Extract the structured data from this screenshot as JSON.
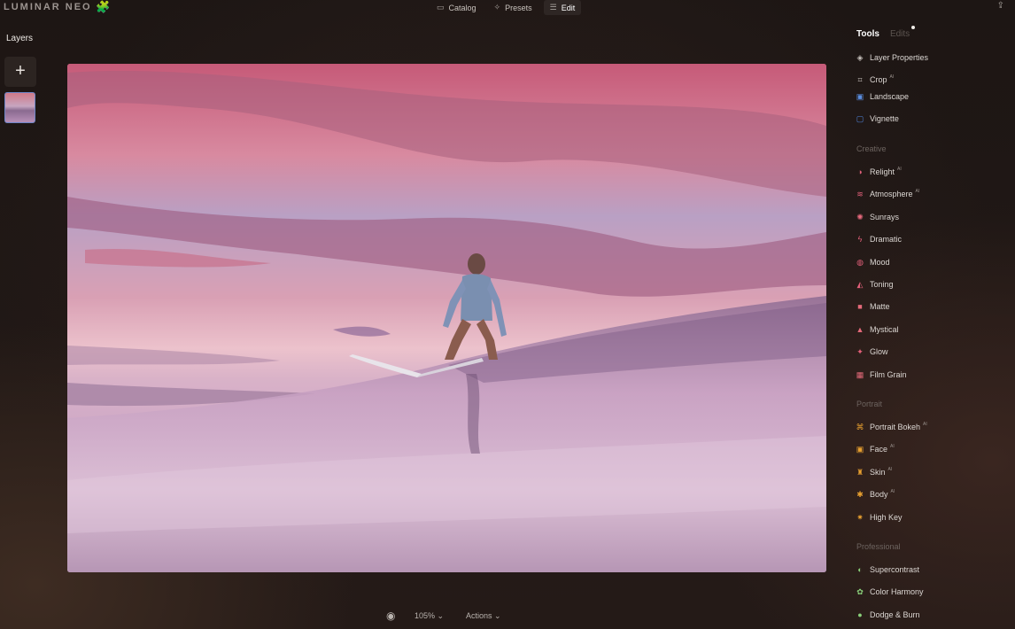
{
  "app": {
    "logo_text": "LUMINAR NEO",
    "logo_badge": "🧩"
  },
  "nav": {
    "catalog": "Catalog",
    "presets": "Presets",
    "edit": "Edit",
    "active": "Edit"
  },
  "layers": {
    "title": "Layers",
    "add_symbol": "+"
  },
  "bottom": {
    "zoom": "105% ⌄",
    "actions": "Actions ⌄"
  },
  "right_panel": {
    "tab_tools": "Tools",
    "tab_edits": "Edits",
    "ai_badge": "AI",
    "tools_top": [
      {
        "label": "Layer Properties",
        "icon": "layers-icon",
        "color": "#c8c2bd",
        "ai": false
      },
      {
        "label": "Crop",
        "icon": "crop-icon",
        "color": "#c8c2bd",
        "ai": true
      },
      {
        "label": "Landscape",
        "icon": "landscape-icon",
        "color": "#5b8ee0",
        "ai": false
      },
      {
        "label": "Vignette",
        "icon": "vignette-icon",
        "color": "#4e82d8",
        "ai": false
      }
    ],
    "section_creative": "Creative",
    "tools_creative": [
      {
        "label": "Relight",
        "icon": "relight-icon",
        "color": "#e0607a",
        "ai": true
      },
      {
        "label": "Atmosphere",
        "icon": "atmosphere-icon",
        "color": "#e0607a",
        "ai": true
      },
      {
        "label": "Sunrays",
        "icon": "sunrays-icon",
        "color": "#e86a7e",
        "ai": false
      },
      {
        "label": "Dramatic",
        "icon": "dramatic-icon",
        "color": "#e4607a",
        "ai": false
      },
      {
        "label": "Mood",
        "icon": "mood-icon",
        "color": "#e4607a",
        "ai": false
      },
      {
        "label": "Toning",
        "icon": "toning-icon",
        "color": "#e4607a",
        "ai": false
      },
      {
        "label": "Matte",
        "icon": "matte-icon",
        "color": "#e46a7a",
        "ai": false
      },
      {
        "label": "Mystical",
        "icon": "mystical-icon",
        "color": "#e46a7a",
        "ai": false
      },
      {
        "label": "Glow",
        "icon": "glow-icon",
        "color": "#e4607a",
        "ai": false
      },
      {
        "label": "Film Grain",
        "icon": "film-grain-icon",
        "color": "#e46a7a",
        "ai": false
      }
    ],
    "section_portrait": "Portrait",
    "tools_portrait": [
      {
        "label": "Portrait Bokeh",
        "icon": "portrait-bokeh-icon",
        "color": "#e8a030",
        "ai": true
      },
      {
        "label": "Face",
        "icon": "face-icon",
        "color": "#e8a030",
        "ai": true
      },
      {
        "label": "Skin",
        "icon": "skin-icon",
        "color": "#e8a030",
        "ai": true
      },
      {
        "label": "Body",
        "icon": "body-icon",
        "color": "#e8a030",
        "ai": true
      },
      {
        "label": "High Key",
        "icon": "high-key-icon",
        "color": "#e8a030",
        "ai": false
      }
    ],
    "section_professional": "Professional",
    "tools_professional": [
      {
        "label": "Supercontrast",
        "icon": "supercontrast-icon",
        "color": "#8ad07a",
        "ai": false
      },
      {
        "label": "Color Harmony",
        "icon": "color-harmony-icon",
        "color": "#8ad07a",
        "ai": false
      },
      {
        "label": "Dodge & Burn",
        "icon": "dodge-burn-icon",
        "color": "#8ad07a",
        "ai": false
      }
    ]
  }
}
